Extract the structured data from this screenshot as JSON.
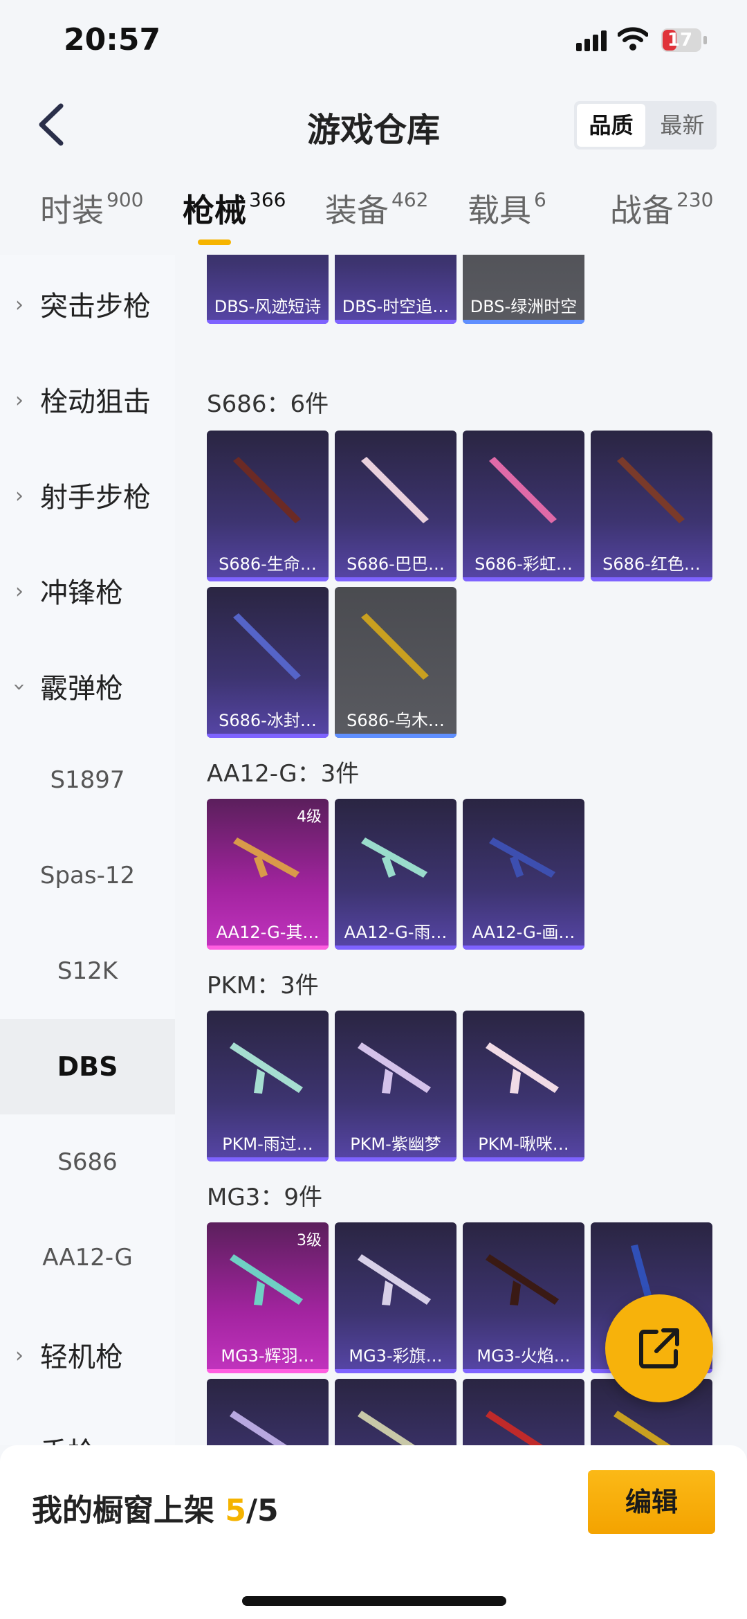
{
  "status": {
    "time": "20:57",
    "battery": "17"
  },
  "header": {
    "title": "游戏仓库",
    "sort_options": [
      "品质",
      "最新"
    ],
    "sort_active": 0
  },
  "tabs": [
    {
      "label": "时装",
      "count": "900"
    },
    {
      "label": "枪械",
      "count": "366",
      "active": true
    },
    {
      "label": "装备",
      "count": "462"
    },
    {
      "label": "载具",
      "count": "6"
    },
    {
      "label": "战备",
      "count": "230"
    }
  ],
  "sidebar": {
    "categories": [
      "突击步枪",
      "栓动狙击",
      "射手步枪",
      "冲锋枪",
      "霰弹枪",
      "轻机枪",
      "手枪"
    ],
    "shotgun_items": [
      "S1897",
      "Spas-12",
      "S12K",
      "DBS",
      "S686",
      "AA12-G"
    ],
    "active_item": "DBS"
  },
  "sections": [
    {
      "title": "",
      "items": [
        "DBS-风迹短诗",
        "DBS-时空追…",
        "DBS-绿洲时空"
      ]
    },
    {
      "title": "S686：6件",
      "items": [
        "S686-生命…",
        "S686-巴巴…",
        "S686-彩虹…",
        "S686-红色…",
        "S686-冰封…",
        "S686-乌木…"
      ]
    },
    {
      "title": "AA12-G：3件",
      "items": [
        "AA12-G-其…",
        "AA12-G-雨…",
        "AA12-G-画…"
      ],
      "level": "4级"
    },
    {
      "title": "PKM：3件",
      "items": [
        "PKM-雨过…",
        "PKM-紫幽梦",
        "PKM-啾咪…"
      ]
    },
    {
      "title": "MG3：9件",
      "items": [
        "MG3-辉羽…",
        "MG3-彩旗…",
        "MG3-火焰…"
      ],
      "level": "3级"
    }
  ],
  "bottom": {
    "label": "我的橱窗上架",
    "current": "5",
    "total": "/5",
    "edit_label": "编辑"
  },
  "colors": {
    "accent": "#f6b400",
    "purple": "#5746a8",
    "pink": "#c234bf"
  }
}
